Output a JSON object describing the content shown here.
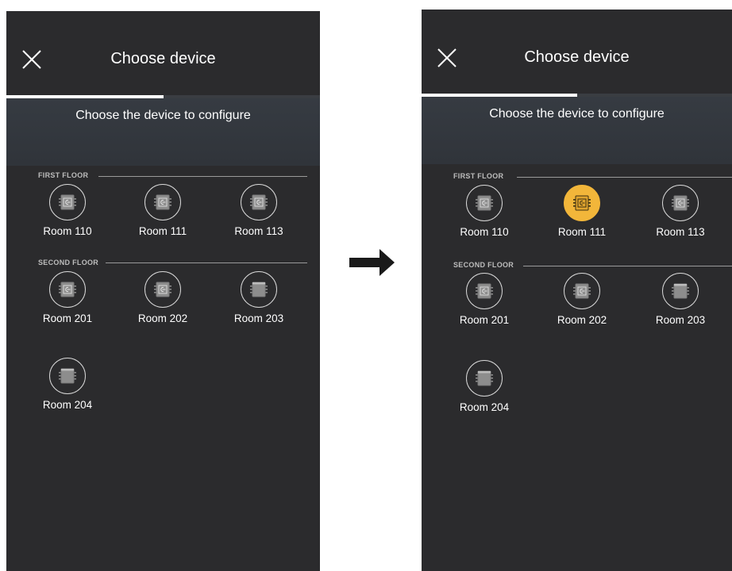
{
  "left_screen": {
    "title": "Choose device",
    "subtitle": "Choose the device to configure",
    "progress_percent": 50,
    "floors": [
      {
        "label": "FIRST FLOOR",
        "devices": [
          {
            "label": "Room 110",
            "type": "keypad",
            "selected": false
          },
          {
            "label": "Room 111",
            "type": "keypad",
            "selected": false
          },
          {
            "label": "Room 113",
            "type": "keypad",
            "selected": false
          }
        ]
      },
      {
        "label": "SECOND FLOOR",
        "devices": [
          {
            "label": "Room 201",
            "type": "keypad",
            "selected": false
          },
          {
            "label": "Room 202",
            "type": "keypad",
            "selected": false
          },
          {
            "label": "Room 203",
            "type": "blank",
            "selected": false
          },
          {
            "label": "Room 204",
            "type": "blank",
            "selected": false
          }
        ]
      }
    ]
  },
  "right_screen": {
    "title": "Choose device",
    "subtitle": "Choose the device to configure",
    "progress_percent": 50,
    "floors": [
      {
        "label": "FIRST FLOOR",
        "devices": [
          {
            "label": "Room 110",
            "type": "keypad",
            "selected": false
          },
          {
            "label": "Room 111",
            "type": "keypad",
            "selected": true
          },
          {
            "label": "Room 113",
            "type": "keypad",
            "selected": false
          }
        ]
      },
      {
        "label": "SECOND FLOOR",
        "devices": [
          {
            "label": "Room 201",
            "type": "keypad",
            "selected": false
          },
          {
            "label": "Room 202",
            "type": "keypad",
            "selected": false
          },
          {
            "label": "Room 203",
            "type": "blank",
            "selected": false
          },
          {
            "label": "Room 204",
            "type": "blank",
            "selected": false
          }
        ]
      }
    ]
  },
  "colors": {
    "background": "#2b2b2d",
    "selected_accent": "#f2b63a",
    "text": "#ffffff",
    "arrow": "#1a1a1a"
  },
  "icons": {
    "close": "close-icon",
    "device": "device-chip-icon",
    "transition": "right-arrow-icon"
  }
}
